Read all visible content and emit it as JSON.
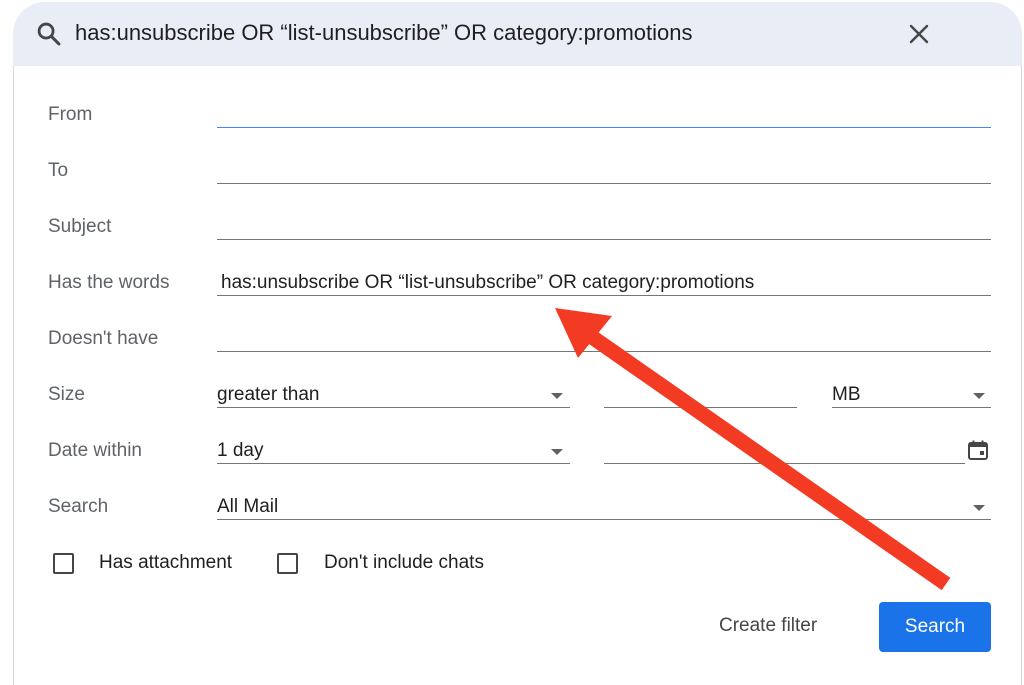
{
  "search_bar": {
    "query": "has:unsubscribe OR “list-unsubscribe” OR category:promotions"
  },
  "form": {
    "from": {
      "label": "From",
      "value": ""
    },
    "to": {
      "label": "To",
      "value": ""
    },
    "subject": {
      "label": "Subject",
      "value": ""
    },
    "has_words": {
      "label": "Has the words",
      "value": "has:unsubscribe OR “list-unsubscribe” OR category:promotions"
    },
    "doesnt_have": {
      "label": "Doesn't have",
      "value": ""
    },
    "size": {
      "label": "Size",
      "comparator": "greater than",
      "amount": "",
      "unit": "MB"
    },
    "date_within": {
      "label": "Date within",
      "range": "1 day",
      "date": ""
    },
    "search_in": {
      "label": "Search",
      "value": "All Mail"
    },
    "has_attachment": {
      "label": "Has attachment",
      "checked": false
    },
    "dont_include_chats": {
      "label": "Don't include chats",
      "checked": false
    }
  },
  "actions": {
    "create_filter": "Create filter",
    "search": "Search"
  },
  "colors": {
    "search_bar_bg": "#e9eef6",
    "primary_button": "#1a73e8",
    "annotation_arrow": "#f33a22"
  }
}
